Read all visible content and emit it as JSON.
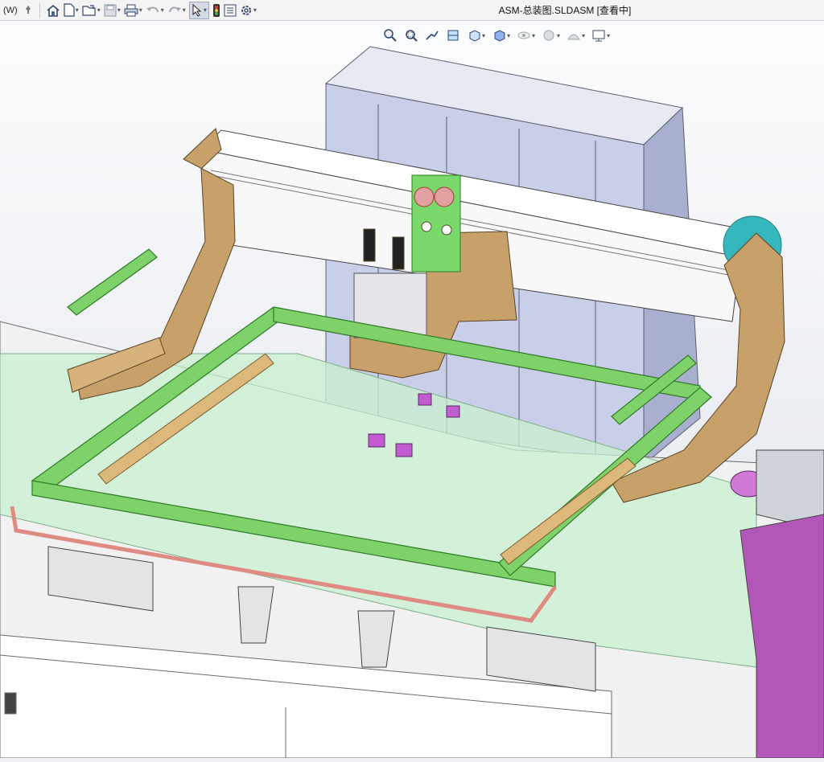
{
  "window": {
    "menu_fragment": "(W)",
    "title": "ASM-总装图.SLDASM [查看中]"
  },
  "toolbar": {
    "left_icons": [
      "pin-icon",
      "home-icon",
      "new-document-icon",
      "open-folder-icon",
      "save-icon",
      "print-icon",
      "undo-icon",
      "redo-icon",
      "select-cursor-icon",
      "rebuild-traffic-light-icon",
      "file-properties-icon",
      "options-gear-icon"
    ]
  },
  "heads_up_toolbar": {
    "icons": [
      "zoom-to-fit-icon",
      "zoom-to-area-icon",
      "previous-view-icon",
      "section-view-icon",
      "view-orientation-icon",
      "display-style-icon",
      "hide-show-items-icon",
      "edit-appearance-icon",
      "apply-scene-icon",
      "view-settings-icon"
    ]
  },
  "colors": {
    "gantry_tan": "#c7a06a",
    "frame_green": "#7fd16a",
    "cabinet_lavender": "#c9cfe9",
    "belt_red": "#e08a84",
    "clamp_magenta": "#c25ad0",
    "side_purple": "#b257b9",
    "glass_green": "#c8f0cf"
  }
}
